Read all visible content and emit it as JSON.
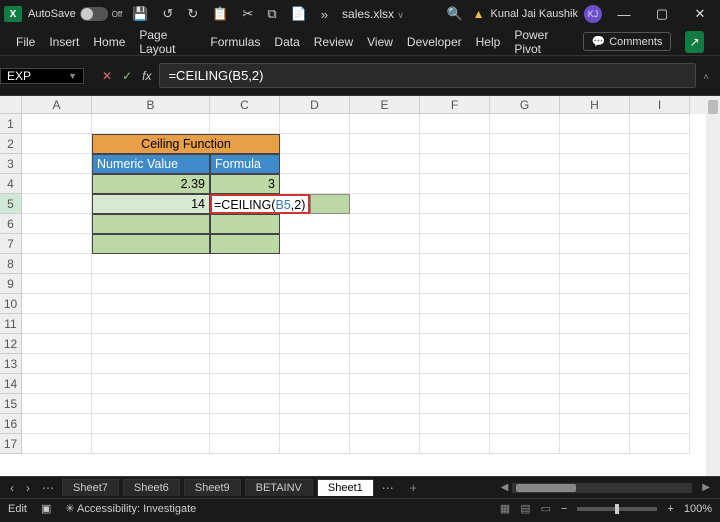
{
  "titlebar": {
    "autosave_label": "AutoSave",
    "autosave_state": "Off",
    "filename": "sales.xlsx",
    "user_name": "Kunal Jai Kaushik",
    "user_initials": "KJ"
  },
  "ribbon": {
    "tabs": [
      "File",
      "Insert",
      "Home",
      "Page Layout",
      "Formulas",
      "Data",
      "Review",
      "View",
      "Developer",
      "Help",
      "Power Pivot"
    ],
    "comments_label": "Comments"
  },
  "formula_bar": {
    "name_box": "EXP",
    "formula": "=CEILING(B5,2)"
  },
  "grid": {
    "columns": [
      "A",
      "B",
      "C",
      "D",
      "E",
      "F",
      "G",
      "H",
      "I"
    ],
    "rows": [
      "1",
      "2",
      "3",
      "4",
      "5",
      "6",
      "7",
      "8",
      "9",
      "10",
      "11",
      "12",
      "13",
      "14",
      "15",
      "16",
      "17"
    ],
    "selected_row": "5",
    "title_cell": "Ceiling Function",
    "headers": {
      "B3": "Numeric Value",
      "C3": "Formula"
    },
    "values": {
      "B4": "2.39",
      "C4": "3",
      "B5": "14"
    },
    "editing": {
      "prefix": "=CEILING(",
      "ref": "B5",
      "suffix": ",2)"
    }
  },
  "sheet_tabs": {
    "tabs": [
      "Sheet7",
      "Sheet6",
      "Sheet9",
      "BETAINV",
      "Sheet1"
    ],
    "active": "Sheet1"
  },
  "status": {
    "mode": "Edit",
    "accessibility": "Accessibility: Investigate",
    "zoom": "100%"
  }
}
